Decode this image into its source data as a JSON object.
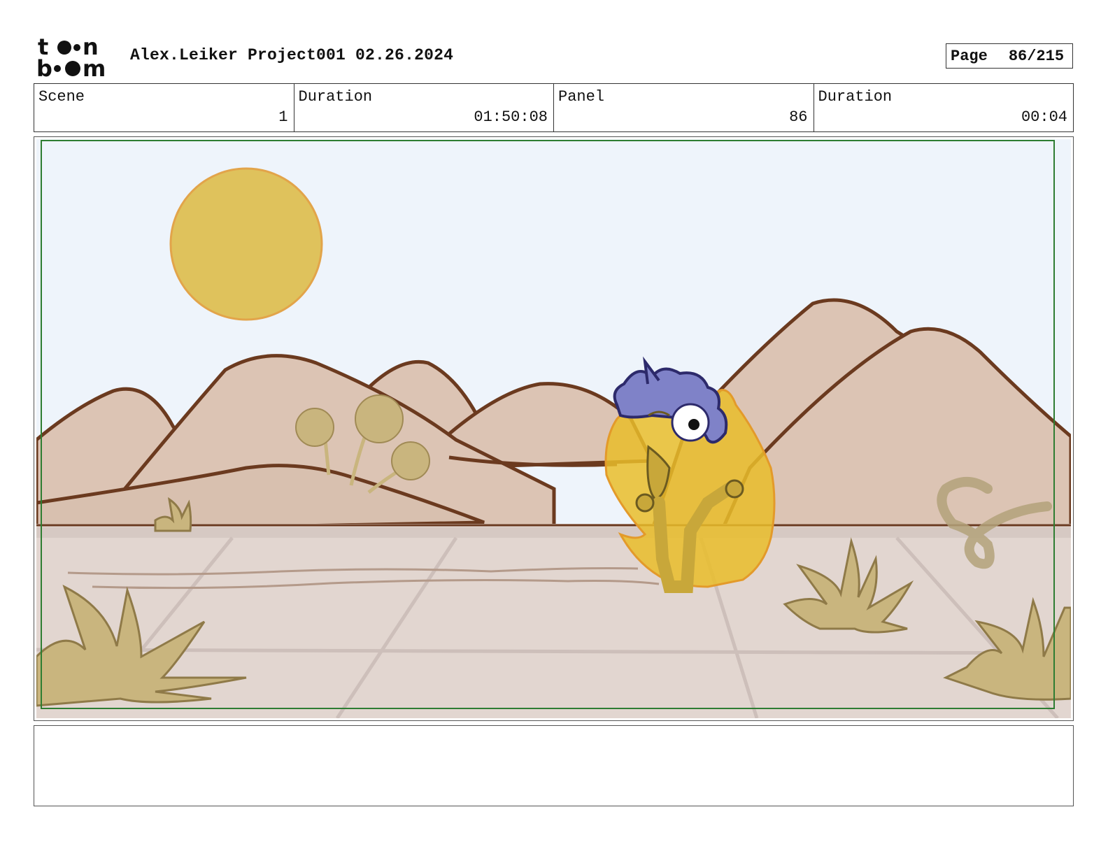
{
  "brand": {
    "logo_icon": "toon-boom-logo-icon"
  },
  "header": {
    "project_title": "Alex.Leiker Project001 02.26.2024",
    "page_label": "Page",
    "page_value": "86/215"
  },
  "info": {
    "scene_label": "Scene",
    "scene_value": "1",
    "scene_duration_label": "Duration",
    "scene_duration_value": "01:50:08",
    "panel_label": "Panel",
    "panel_value": "86",
    "panel_duration_label": "Duration",
    "panel_duration_value": "00:04"
  },
  "artwork": {
    "description_icon": "storyboard-panel-illustration",
    "colors": {
      "sky": "#eef4fb",
      "sun": "#dfc25c",
      "hills": "#dcc4b4",
      "outline": "#6b3a1f",
      "ground": "#e2d6d0",
      "plants": "#c9b57e",
      "flame": "#e9bd2a",
      "hair": "#7f82c8",
      "safe_frame": "#2e7d32"
    }
  },
  "notes": {
    "text": ""
  }
}
